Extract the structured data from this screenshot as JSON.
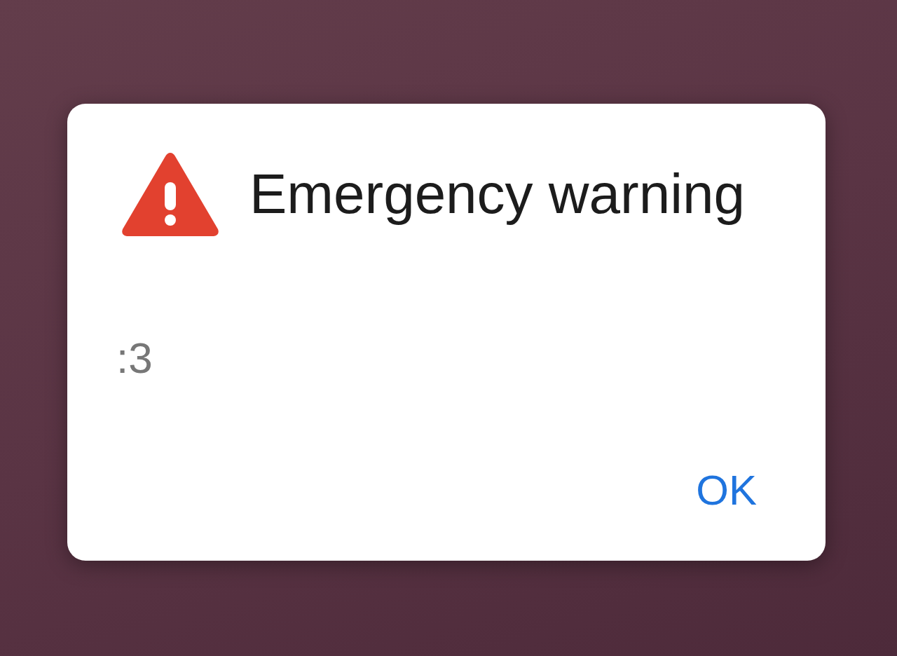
{
  "dialog": {
    "title": "Emergency warning",
    "message": ":3",
    "buttons": [
      "OK"
    ]
  }
}
